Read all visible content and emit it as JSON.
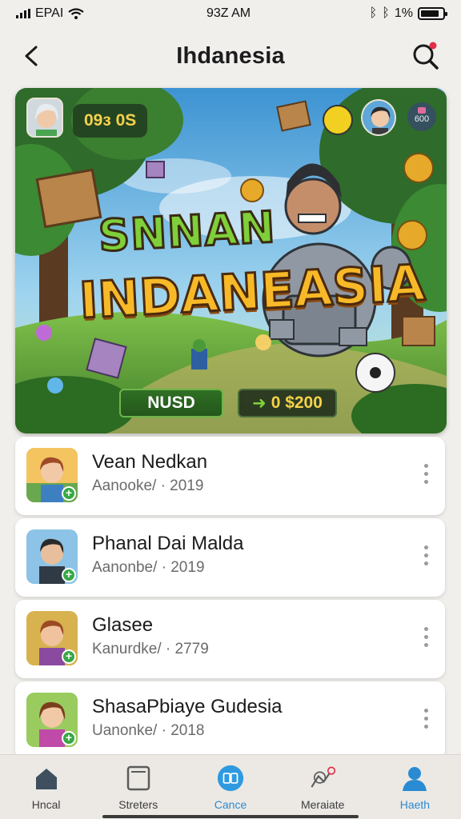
{
  "status_bar": {
    "carrier": "EPAI",
    "time": "93Z AM",
    "battery_text": "1%"
  },
  "header": {
    "title": "Ihdanesia"
  },
  "banner": {
    "score": "09з 0S",
    "badge": "600",
    "title_line1": "SNNAN",
    "title_line2": "INDANEASIA",
    "currency_button": "NUSD",
    "amount_arrow": "➜",
    "amount": "0 $200"
  },
  "list": {
    "items": [
      {
        "name": "Vean Nedkan",
        "meta": "Aanooke/ · 2019",
        "thumb_bg": "#e8b24a"
      },
      {
        "name": "Phanal Dai Malda",
        "meta": "Aanonbe/ · 2019",
        "thumb_bg": "#7fb3d9"
      },
      {
        "name": "Glasee",
        "meta": "Kanurdke/ · 2779",
        "thumb_bg": "#d9a048"
      },
      {
        "name": "ShasaPbiaye Gudesia",
        "meta": "Uanonke/ · 2018",
        "thumb_bg": "#8cc45a"
      }
    ]
  },
  "bottom_nav": {
    "items": [
      {
        "label": "Hncal",
        "icon": "home-icon"
      },
      {
        "label": "Streters",
        "icon": "tablet-icon"
      },
      {
        "label": "Cance",
        "icon": "game-circle-icon"
      },
      {
        "label": "Meraiate",
        "icon": "notification-icon"
      },
      {
        "label": "Haeth",
        "icon": "profile-icon"
      }
    ]
  },
  "colors": {
    "accent_blue": "#2a8bd3",
    "notification_red": "#e0304a"
  }
}
